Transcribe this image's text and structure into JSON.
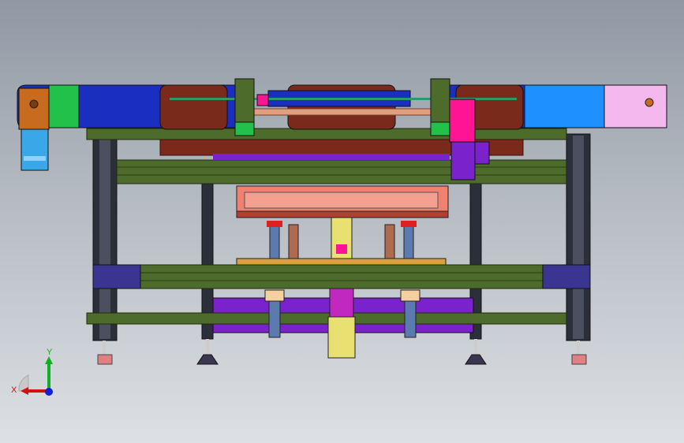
{
  "viewport": {
    "background_top": "#8f98a3",
    "background_bottom": "#dde0e4"
  },
  "triad": {
    "x_label": "X",
    "y_label": "Y",
    "x_color": "#d21010",
    "y_color": "#10b020",
    "z_color": "#1020d0"
  },
  "colors": {
    "frame_dark": "#2b2f3a",
    "frame_green": "#4d6b2a",
    "rail_green": "#6e8f3a",
    "belt_blue": "#1a2fbf",
    "belt_lightblue": "#1e90ff",
    "belt_green": "#22c24a",
    "belt_pink": "#f4b8ee",
    "plate_brown": "#7a2a1a",
    "motor_blue": "#3aa8e8",
    "motor_orange": "#c86b1e",
    "magenta": "#ff1493",
    "purple": "#7a22cc",
    "salmon": "#f08070",
    "yellow": "#e8e070",
    "copper": "#b06a50"
  }
}
